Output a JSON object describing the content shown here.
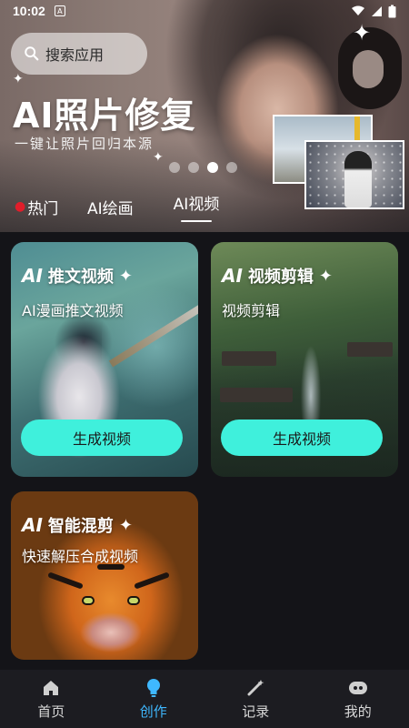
{
  "status_bar": {
    "time": "10:02"
  },
  "search": {
    "placeholder": "搜索应用"
  },
  "banner": {
    "title": "AI照片修复",
    "subtitle": "一键让照片回归本源",
    "page_indicator": {
      "total": 4,
      "active": 3
    }
  },
  "tabs": [
    {
      "label": "热门",
      "icon": "flame-icon",
      "active": false
    },
    {
      "label": "AI绘画",
      "active": false
    },
    {
      "label": "AI视频",
      "active": true
    }
  ],
  "cards": [
    {
      "logo": "AI",
      "title": "推文视频",
      "subtitle": "AI漫画推文视频",
      "button": "生成视频"
    },
    {
      "logo": "AI",
      "title": "视频剪辑",
      "subtitle": "视频剪辑",
      "button": "生成视频"
    },
    {
      "logo": "AI",
      "title": "智能混剪",
      "subtitle": "快速解压合成视频"
    }
  ],
  "bottom_nav": [
    {
      "label": "首页",
      "icon": "home-icon",
      "active": false
    },
    {
      "label": "创作",
      "icon": "bulb-icon",
      "active": true
    },
    {
      "label": "记录",
      "icon": "magic-wand-icon",
      "active": false
    },
    {
      "label": "我的",
      "icon": "profile-icon",
      "active": false
    }
  ],
  "colors": {
    "accent": "#3fb8ff",
    "button": "#3ff0dc",
    "hot": "#e11d2a",
    "background": "#141418"
  }
}
